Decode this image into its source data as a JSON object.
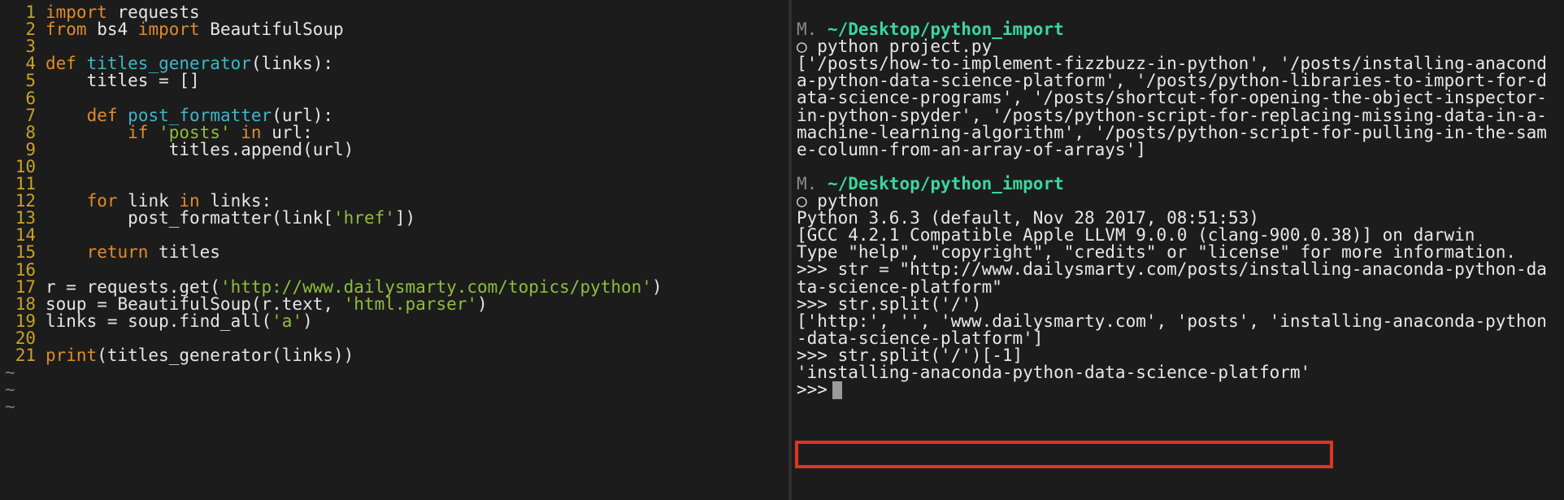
{
  "editor": {
    "lines": [
      {
        "n": "1",
        "tokens": [
          {
            "t": "import",
            "c": "kw"
          },
          {
            "t": " requests",
            "c": ""
          }
        ]
      },
      {
        "n": "2",
        "tokens": [
          {
            "t": "from",
            "c": "kw"
          },
          {
            "t": " bs4 ",
            "c": ""
          },
          {
            "t": "import",
            "c": "kw"
          },
          {
            "t": " BeautifulSoup",
            "c": ""
          }
        ]
      },
      {
        "n": "3",
        "tokens": []
      },
      {
        "n": "4",
        "tokens": [
          {
            "t": "def",
            "c": "kw"
          },
          {
            "t": " ",
            "c": ""
          },
          {
            "t": "titles_generator",
            "c": "fn"
          },
          {
            "t": "(links):",
            "c": ""
          }
        ]
      },
      {
        "n": "5",
        "tokens": [
          {
            "t": "    titles = []",
            "c": ""
          }
        ]
      },
      {
        "n": "6",
        "tokens": []
      },
      {
        "n": "7",
        "tokens": [
          {
            "t": "    ",
            "c": ""
          },
          {
            "t": "def",
            "c": "kw"
          },
          {
            "t": " ",
            "c": ""
          },
          {
            "t": "post_formatter",
            "c": "fn"
          },
          {
            "t": "(url):",
            "c": ""
          }
        ]
      },
      {
        "n": "8",
        "tokens": [
          {
            "t": "        ",
            "c": ""
          },
          {
            "t": "if",
            "c": "kw"
          },
          {
            "t": " ",
            "c": ""
          },
          {
            "t": "'posts'",
            "c": "str"
          },
          {
            "t": " ",
            "c": ""
          },
          {
            "t": "in",
            "c": "kw"
          },
          {
            "t": " url:",
            "c": ""
          }
        ]
      },
      {
        "n": "9",
        "tokens": [
          {
            "t": "            titles.append(url)",
            "c": ""
          }
        ]
      },
      {
        "n": "10",
        "tokens": []
      },
      {
        "n": "11",
        "tokens": []
      },
      {
        "n": "12",
        "tokens": [
          {
            "t": "    ",
            "c": ""
          },
          {
            "t": "for",
            "c": "kw"
          },
          {
            "t": " link ",
            "c": ""
          },
          {
            "t": "in",
            "c": "kw"
          },
          {
            "t": " links:",
            "c": ""
          }
        ]
      },
      {
        "n": "13",
        "tokens": [
          {
            "t": "        post_formatter(link[",
            "c": ""
          },
          {
            "t": "'href'",
            "c": "str"
          },
          {
            "t": "])",
            "c": ""
          }
        ]
      },
      {
        "n": "14",
        "tokens": []
      },
      {
        "n": "15",
        "tokens": [
          {
            "t": "    ",
            "c": ""
          },
          {
            "t": "return",
            "c": "kw"
          },
          {
            "t": " titles",
            "c": ""
          }
        ]
      },
      {
        "n": "16",
        "tokens": []
      },
      {
        "n": "17",
        "tokens": [
          {
            "t": "r = requests.get(",
            "c": ""
          },
          {
            "t": "'http://www.dailysmarty.com/topics/python'",
            "c": "str"
          },
          {
            "t": ")",
            "c": ""
          }
        ]
      },
      {
        "n": "18",
        "tokens": [
          {
            "t": "soup = BeautifulSoup(r.text, ",
            "c": ""
          },
          {
            "t": "'html.parser'",
            "c": "str"
          },
          {
            "t": ")",
            "c": ""
          }
        ]
      },
      {
        "n": "19",
        "tokens": [
          {
            "t": "links = soup.find_all(",
            "c": ""
          },
          {
            "t": "'a'",
            "c": "str"
          },
          {
            "t": ")",
            "c": ""
          }
        ]
      },
      {
        "n": "20",
        "tokens": []
      },
      {
        "n": "21",
        "tokens": [
          {
            "t": "print",
            "c": "kw"
          },
          {
            "t": "(titles_generator(links))",
            "c": ""
          }
        ]
      }
    ],
    "tildes": [
      "~",
      "~",
      "~"
    ]
  },
  "terminal": {
    "lines": [
      {
        "parts": [
          {
            "t": "M. ",
            "c": "m"
          },
          {
            "t": "~/Desktop/python_import",
            "c": "path"
          }
        ]
      },
      {
        "parts": [
          {
            "t": "○ python project.py",
            "c": ""
          }
        ]
      },
      {
        "parts": [
          {
            "t": "['/posts/how-to-implement-fizzbuzz-in-python', '/posts/installing-anacond",
            "c": ""
          }
        ]
      },
      {
        "parts": [
          {
            "t": "a-python-data-science-platform', '/posts/python-libraries-to-import-for-d",
            "c": ""
          }
        ]
      },
      {
        "parts": [
          {
            "t": "ata-science-programs', '/posts/shortcut-for-opening-the-object-inspector-",
            "c": ""
          }
        ]
      },
      {
        "parts": [
          {
            "t": "in-python-spyder', '/posts/python-script-for-replacing-missing-data-in-a-",
            "c": ""
          }
        ]
      },
      {
        "parts": [
          {
            "t": "machine-learning-algorithm', '/posts/python-script-for-pulling-in-the-sam",
            "c": ""
          }
        ]
      },
      {
        "parts": [
          {
            "t": "e-column-from-an-array-of-arrays']",
            "c": ""
          }
        ]
      },
      {
        "parts": []
      },
      {
        "parts": [
          {
            "t": "M. ",
            "c": "m"
          },
          {
            "t": "~/Desktop/python_import",
            "c": "path"
          }
        ]
      },
      {
        "parts": [
          {
            "t": "○ python",
            "c": ""
          }
        ]
      },
      {
        "parts": [
          {
            "t": "Python 3.6.3 (default, Nov 28 2017, 08:51:53)",
            "c": ""
          }
        ]
      },
      {
        "parts": [
          {
            "t": "[GCC 4.2.1 Compatible Apple LLVM 9.0.0 (clang-900.0.38)] on darwin",
            "c": ""
          }
        ]
      },
      {
        "parts": [
          {
            "t": "Type \"help\", \"copyright\", \"credits\" or \"license\" for more information.",
            "c": ""
          }
        ]
      },
      {
        "parts": [
          {
            "t": ">>> str = \"http://www.dailysmarty.com/posts/installing-anaconda-python-da",
            "c": ""
          }
        ]
      },
      {
        "parts": [
          {
            "t": "ta-science-platform\"",
            "c": ""
          }
        ]
      },
      {
        "parts": [
          {
            "t": ">>> str.split('/')",
            "c": ""
          }
        ]
      },
      {
        "parts": [
          {
            "t": "['http:', '', 'www.dailysmarty.com', 'posts', 'installing-anaconda-python",
            "c": ""
          }
        ]
      },
      {
        "parts": [
          {
            "t": "-data-science-platform']",
            "c": ""
          }
        ]
      },
      {
        "parts": [
          {
            "t": ">>> str.split('/')[-1]",
            "c": ""
          }
        ]
      },
      {
        "parts": [
          {
            "t": "'installing-anaconda-python-data-science-platform'",
            "c": ""
          }
        ]
      }
    ],
    "prompt": ">>>"
  }
}
